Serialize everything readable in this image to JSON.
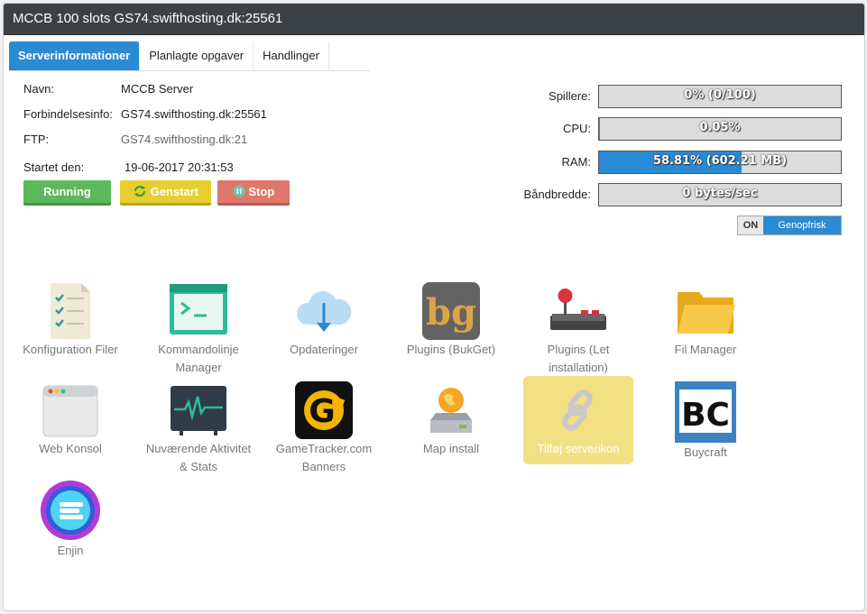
{
  "window": {
    "title": "MCCB 100 slots GS74.swifthosting.dk:25561"
  },
  "tabs": [
    {
      "label": "Serverinformationer",
      "active": true
    },
    {
      "label": "Planlagte opgaver",
      "active": false
    },
    {
      "label": "Handlinger",
      "active": false
    }
  ],
  "server": {
    "name_label": "Navn:",
    "name": "MCCB Server",
    "conn_label": "Forbindelsesinfo:",
    "conn": "GS74.swifthosting.dk:25561",
    "ftp_label": "FTP:",
    "ftp": "GS74.swifthosting.dk:21",
    "started_label": "Startet den:",
    "started": "19-06-2017 20:31:53"
  },
  "buttons": {
    "running": {
      "label": "Running",
      "color": "#5cb85c"
    },
    "restart": {
      "label": "Genstart",
      "color": "#e6cf2e",
      "icon": "refresh-icon"
    },
    "stop": {
      "label": "Stop",
      "color": "#e0776b",
      "icon": "pause-icon"
    }
  },
  "stats": [
    {
      "label": "Spillere:",
      "text": "0% (0/100)",
      "fraction": 0.0
    },
    {
      "label": "CPU:",
      "text": "0.05%",
      "fraction": 0.0005
    },
    {
      "label": "RAM:",
      "text": "58.81% (602.21 MB)",
      "fraction": 0.5881
    },
    {
      "label": "Båndbredde:",
      "text": "0 bytes/sec",
      "fraction": 0.0
    }
  ],
  "refresh_toggle": {
    "state": "ON",
    "label": "Genopfrisk"
  },
  "tools": [
    {
      "label": "Konfiguration Filer",
      "icon": "config-file-icon"
    },
    {
      "label": "Kommandolinje Manager",
      "icon": "terminal-icon"
    },
    {
      "label": "Opdateringer",
      "icon": "cloud-download-icon"
    },
    {
      "label": "Plugins (BukGet)",
      "icon": "bukget-icon",
      "icon_text": "bg"
    },
    {
      "label": "Plugins (Let installation)",
      "icon": "joystick-icon"
    },
    {
      "label": "Fil Manager",
      "icon": "folder-icon"
    },
    {
      "label": "Web Konsol",
      "icon": "browser-window-icon"
    },
    {
      "label": "Nuværende Aktivitet & Stats",
      "icon": "activity-monitor-icon"
    },
    {
      "label": "GameTracker.com Banners",
      "icon": "gametracker-icon",
      "icon_text": "G"
    },
    {
      "label": "Map install",
      "icon": "map-install-icon"
    },
    {
      "label": "Tilføj serverikon",
      "icon": "chain-link-icon",
      "highlight": true
    },
    {
      "label": "Buycraft",
      "icon": "buycraft-icon",
      "icon_text": "BC"
    },
    {
      "label": "Enjin",
      "icon": "enjin-icon"
    }
  ]
}
